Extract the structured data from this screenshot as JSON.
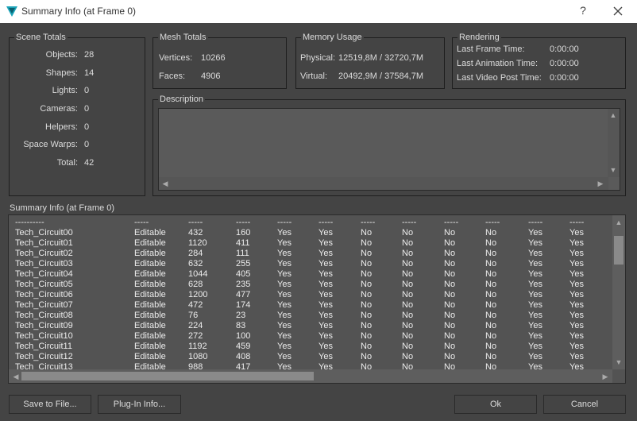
{
  "window": {
    "title": "Summary Info (at Frame 0)",
    "help_label": "?",
    "app_icon": "3ds-max-icon",
    "close_icon": "close-icon"
  },
  "scene_totals": {
    "title": "Scene Totals",
    "rows": [
      {
        "label": "Objects:",
        "value": "28"
      },
      {
        "label": "Shapes:",
        "value": "14"
      },
      {
        "label": "Lights:",
        "value": "0"
      },
      {
        "label": "Cameras:",
        "value": "0"
      },
      {
        "label": "Helpers:",
        "value": "0"
      },
      {
        "label": "Space Warps:",
        "value": "0"
      },
      {
        "label": "Total:",
        "value": "42"
      }
    ]
  },
  "mesh_totals": {
    "title": "Mesh Totals",
    "rows": [
      {
        "label": "Vertices:",
        "value": "10266"
      },
      {
        "label": "Faces:",
        "value": "4906"
      }
    ]
  },
  "memory_usage": {
    "title": "Memory Usage",
    "rows": [
      {
        "label": "Physical:",
        "value": "12519,8M / 32720,7M"
      },
      {
        "label": "Virtual:",
        "value": "20492,9M / 37584,7M"
      }
    ]
  },
  "rendering": {
    "title": "Rendering",
    "rows": [
      {
        "label": "Last Frame Time:",
        "value": "0:00:00"
      },
      {
        "label": "Last Animation Time:",
        "value": "0:00:00"
      },
      {
        "label": "Last Video Post Time:",
        "value": "0:00:00"
      }
    ]
  },
  "description": {
    "title": "Description",
    "text": ""
  },
  "summary": {
    "title": "Summary Info (at Frame 0)",
    "separator": [
      "----------",
      "-----",
      "-----",
      "-----",
      "-----",
      "-----",
      "-----",
      "-----",
      "-----",
      "-----",
      "-----",
      "-----"
    ],
    "rows": [
      [
        "Tech_Circuit00",
        "Editable",
        "432",
        "160",
        "Yes",
        "Yes",
        "No",
        "No",
        "No",
        "No",
        "Yes",
        "Yes"
      ],
      [
        "Tech_Circuit01",
        "Editable",
        "1120",
        "411",
        "Yes",
        "Yes",
        "No",
        "No",
        "No",
        "No",
        "Yes",
        "Yes"
      ],
      [
        "Tech_Circuit02",
        "Editable",
        "284",
        "111",
        "Yes",
        "Yes",
        "No",
        "No",
        "No",
        "No",
        "Yes",
        "Yes"
      ],
      [
        "Tech_Circuit03",
        "Editable",
        "632",
        "255",
        "Yes",
        "Yes",
        "No",
        "No",
        "No",
        "No",
        "Yes",
        "Yes"
      ],
      [
        "Tech_Circuit04",
        "Editable",
        "1044",
        "405",
        "Yes",
        "Yes",
        "No",
        "No",
        "No",
        "No",
        "Yes",
        "Yes"
      ],
      [
        "Tech_Circuit05",
        "Editable",
        "628",
        "235",
        "Yes",
        "Yes",
        "No",
        "No",
        "No",
        "No",
        "Yes",
        "Yes"
      ],
      [
        "Tech_Circuit06",
        "Editable",
        "1200",
        "477",
        "Yes",
        "Yes",
        "No",
        "No",
        "No",
        "No",
        "Yes",
        "Yes"
      ],
      [
        "Tech_Circuit07",
        "Editable",
        "472",
        "174",
        "Yes",
        "Yes",
        "No",
        "No",
        "No",
        "No",
        "Yes",
        "Yes"
      ],
      [
        "Tech_Circuit08",
        "Editable",
        "76",
        "23",
        "Yes",
        "Yes",
        "No",
        "No",
        "No",
        "No",
        "Yes",
        "Yes"
      ],
      [
        "Tech_Circuit09",
        "Editable",
        "224",
        "83",
        "Yes",
        "Yes",
        "No",
        "No",
        "No",
        "No",
        "Yes",
        "Yes"
      ],
      [
        "Tech_Circuit10",
        "Editable",
        "272",
        "100",
        "Yes",
        "Yes",
        "No",
        "No",
        "No",
        "No",
        "Yes",
        "Yes"
      ],
      [
        "Tech_Circuit11",
        "Editable",
        "1192",
        "459",
        "Yes",
        "Yes",
        "No",
        "No",
        "No",
        "No",
        "Yes",
        "Yes"
      ],
      [
        "Tech_Circuit12",
        "Editable",
        "1080",
        "408",
        "Yes",
        "Yes",
        "No",
        "No",
        "No",
        "No",
        "Yes",
        "Yes"
      ],
      [
        "Tech_Circuit13",
        "Editable",
        "988",
        "417",
        "Yes",
        "Yes",
        "No",
        "No",
        "No",
        "No",
        "Yes",
        "Yes"
      ]
    ]
  },
  "buttons": {
    "save": "Save to File...",
    "plugin": "Plug-In Info...",
    "ok": "Ok",
    "cancel": "Cancel"
  },
  "colors": {
    "background": "#444444",
    "panel_border": "#1e1e1e",
    "list_background": "#535353",
    "text": "#dcdcdc"
  }
}
